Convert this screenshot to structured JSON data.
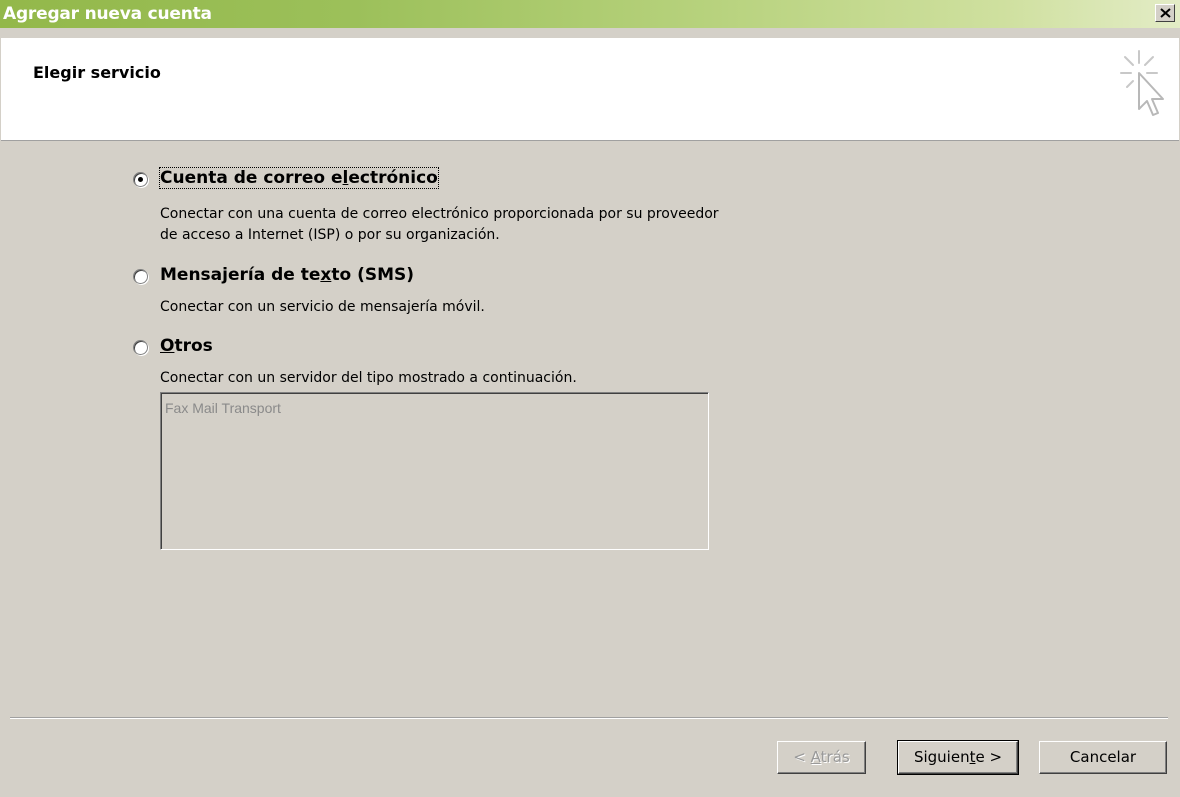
{
  "window": {
    "title": "Agregar nueva cuenta",
    "close_label": "Cerrar"
  },
  "header": {
    "step_title": "Elegir servicio"
  },
  "options": [
    {
      "label_before": "Cuenta de correo e",
      "label_mnemonic": "l",
      "label_after": "ectrónico",
      "selected": true,
      "description_lines": [
        "Conectar con una cuenta de correo electrónico proporcionada por su proveedor",
        "de acceso a Internet (ISP) o por su organización."
      ]
    },
    {
      "label_before": "Mensajería de te",
      "label_mnemonic": "x",
      "label_after": "to (SMS)",
      "selected": false,
      "description_lines": [
        "Conectar con un servicio de mensajería móvil."
      ]
    },
    {
      "label_before": "",
      "label_mnemonic": "O",
      "label_after": "tros",
      "selected": false,
      "description_lines": [
        "Conectar con un servidor del tipo mostrado a continuación."
      ]
    }
  ],
  "server_list": {
    "items": [
      "Fax Mail Transport"
    ],
    "enabled": false
  },
  "buttons": {
    "back": {
      "prefix": "< ",
      "mnemonic": "A",
      "rest": "trás",
      "enabled": false
    },
    "next": {
      "prefix": "Siguien",
      "mnemonic": "t",
      "rest": "e >",
      "enabled": true
    },
    "cancel": {
      "label": "Cancelar",
      "enabled": true
    }
  },
  "colors": {
    "titlebar_start": "#93b84a",
    "titlebar_end": "#e3ecc6",
    "dialog_bg": "#d4d0c8",
    "header_bg": "#ffffff",
    "disabled_text": "#9a9a9a"
  },
  "icons": {
    "close": "close-x-icon",
    "wizard": "cursor-click-sparkle-icon"
  }
}
